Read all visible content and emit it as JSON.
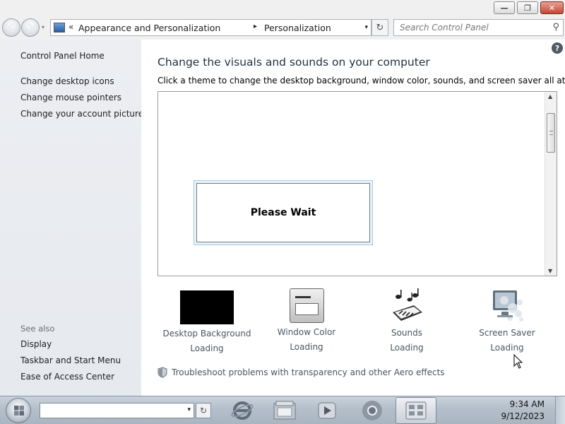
{
  "window": {
    "minimize_glyph": "—",
    "maximize_glyph": "❐",
    "close_glyph": "✕"
  },
  "address_bar": {
    "chevron": "«",
    "breadcrumbs": [
      "Appearance and Personalization",
      "Personalization"
    ],
    "separator": "▸",
    "dropdown_glyph": "▾",
    "refresh_glyph": "↻"
  },
  "search": {
    "placeholder": "Search Control Panel",
    "icon": "search-icon",
    "glyph": "⚲"
  },
  "left_pane": {
    "home": "Control Panel Home",
    "tasks": [
      "Change desktop icons",
      "Change mouse pointers",
      "Change your account picture"
    ],
    "see_also_label": "See also",
    "see_also": [
      "Display",
      "Taskbar and Start Menu",
      "Ease of Access Center"
    ]
  },
  "main": {
    "help_glyph": "?",
    "heading": "Change the visuals and sounds on your computer",
    "subheading": "Click a theme to change the desktop background, window color, sounds, and screen saver all at once.",
    "wait_message": "Please Wait",
    "scroll_up": "▲",
    "scroll_down": "▼",
    "options": [
      {
        "label": "Desktop Background",
        "status": "Loading",
        "icon": "desktop-background-icon"
      },
      {
        "label": "Window Color",
        "status": "Loading",
        "icon": "window-color-icon"
      },
      {
        "label": "Sounds",
        "status": "Loading",
        "icon": "sounds-icon"
      },
      {
        "label": "Screen Saver",
        "status": "Loading",
        "icon": "screen-saver-icon"
      }
    ],
    "troubleshoot": "Troubleshoot problems with transparency and other Aero effects"
  },
  "taskbar": {
    "combo_dropdown": "▾",
    "go_glyph": "↻",
    "apps": [
      "internet-explorer-icon",
      "file-explorer-icon",
      "media-player-icon",
      "chrome-icon",
      "control-panel-icon"
    ],
    "time": "9:34 AM",
    "date": "9/12/2023"
  },
  "colors": {
    "accent_waitbox": "#a5c9e2",
    "desktop_background_swatch": "#000000"
  }
}
